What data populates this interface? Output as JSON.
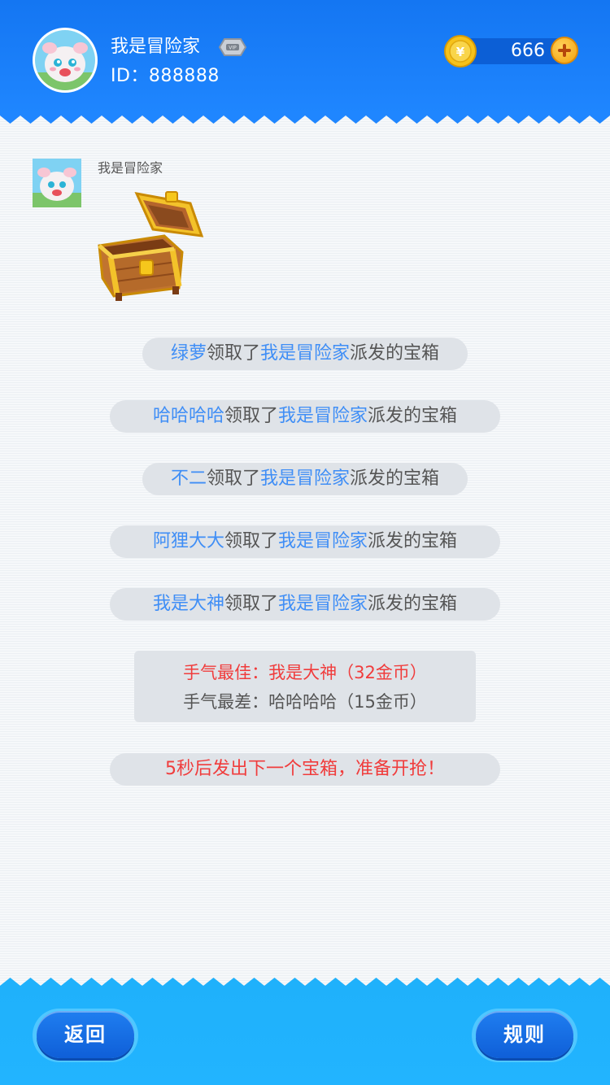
{
  "header": {
    "username": "我是冒险家",
    "user_id": "ID：888888",
    "vip_badge": "VIP",
    "coins": "666"
  },
  "chat": {
    "sender_name": "我是冒险家"
  },
  "messages": [
    {
      "claimer": "绿萝",
      "mid1": "领取了",
      "sender": "我是冒险家",
      "tail": "派发的宝箱"
    },
    {
      "claimer": "哈哈哈哈",
      "mid1": "领取了",
      "sender": "我是冒险家",
      "tail": "派发的宝箱"
    },
    {
      "claimer": "不二",
      "mid1": "领取了",
      "sender": "我是冒险家",
      "tail": "派发的宝箱"
    },
    {
      "claimer": "阿狸大大",
      "mid1": "领取了",
      "sender": "我是冒险家",
      "tail": "派发的宝箱"
    },
    {
      "claimer": "我是大神",
      "mid1": "领取了",
      "sender": "我是冒险家",
      "tail": "派发的宝箱"
    }
  ],
  "summary": {
    "best": "手气最佳：我是大神（32金币）",
    "worst": "手气最差：哈哈哈哈（15金币）"
  },
  "notice": "5秒后发出下一个宝箱，准备开抢！",
  "footer": {
    "back_label": "返回",
    "rules_label": "规则"
  },
  "colors": {
    "header_blue": "#1476f2",
    "footer_blue": "#22b4ff",
    "highlight": "#3f8ef6",
    "alert_red": "#f03c3c"
  },
  "icons": {
    "coin": "gold-coin-icon",
    "plus": "plus-icon",
    "vip": "vip-badge-icon",
    "treasure": "treasure-chest-icon"
  }
}
